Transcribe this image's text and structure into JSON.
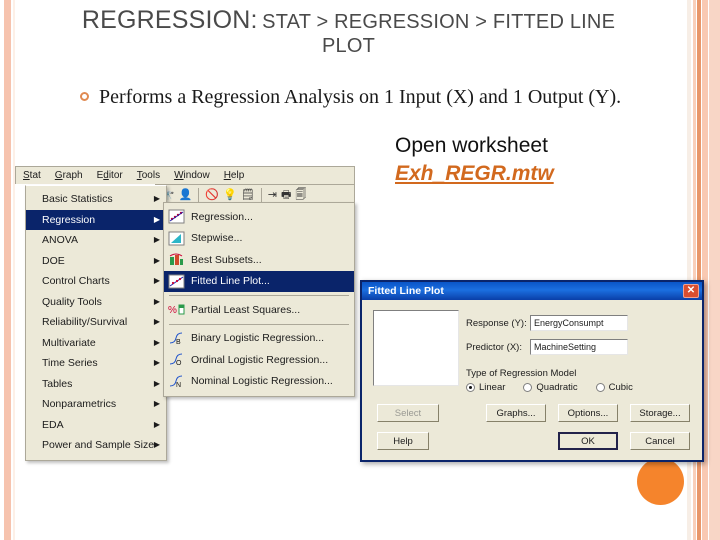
{
  "slide": {
    "title_main": "REGRESSION:",
    "title_path": "STAT > REGRESSION > FITTED LINE",
    "title_path_line2": "PLOT",
    "bullet_text": "Performs a Regression Analysis on 1 Input (X) and 1 Output (Y).",
    "worksheet_label": "Open worksheet",
    "worksheet_file": "Exh_REGR.mtw"
  },
  "colors": {
    "accent_orange": "#f5842c",
    "link_orange": "#d2691e",
    "stripe_peach": "#f6c3ae",
    "title_gray": "#4a4a4a",
    "menu_highlight": "#0a246a",
    "dialog_face": "#ece9d8"
  },
  "minitab": {
    "menubar": [
      {
        "label": "Stat",
        "accel": "S"
      },
      {
        "label": "Graph",
        "accel": "G"
      },
      {
        "label": "Editor",
        "accel": "d"
      },
      {
        "label": "Tools",
        "accel": "T"
      },
      {
        "label": "Window",
        "accel": "W"
      },
      {
        "label": "Help",
        "accel": "H"
      }
    ],
    "toolbar_icons": [
      "binoculars-icon",
      "person-find-icon",
      "no-entry-icon",
      "lightbulb-icon",
      "note-icon",
      "separator",
      "insert-cell-icon",
      "printer-icon",
      "print-preview-icon",
      "partial-icon"
    ],
    "stat_menu": [
      {
        "label": "Basic Statistics",
        "accel": "B",
        "selected": false,
        "submenu": true
      },
      {
        "label": "Regression",
        "accel": "R",
        "selected": true,
        "submenu": true
      },
      {
        "label": "ANOVA",
        "accel": "A",
        "selected": false,
        "submenu": true
      },
      {
        "label": "DOE",
        "accel": "D",
        "selected": false,
        "submenu": true
      },
      {
        "label": "Control Charts",
        "accel": "C",
        "selected": false,
        "submenu": true
      },
      {
        "label": "Quality Tools",
        "accel": "Q",
        "selected": false,
        "submenu": true
      },
      {
        "label": "Reliability/Survival",
        "accel": "l",
        "selected": false,
        "submenu": true
      },
      {
        "label": "Multivariate",
        "accel": "M",
        "selected": false,
        "submenu": true
      },
      {
        "label": "Time Series",
        "accel": "S",
        "selected": false,
        "submenu": true
      },
      {
        "label": "Tables",
        "accel": "T",
        "selected": false,
        "submenu": true
      },
      {
        "label": "Nonparametrics",
        "accel": "N",
        "selected": false,
        "submenu": true
      },
      {
        "label": "EDA",
        "accel": "E",
        "selected": false,
        "submenu": true
      },
      {
        "label": "Power and Sample Size",
        "accel": "P",
        "selected": false,
        "submenu": true
      }
    ],
    "regression_submenu": [
      {
        "label": "Regression...",
        "accel": "R",
        "selected": false,
        "icon": "scatter-plot-icon"
      },
      {
        "label": "Stepwise...",
        "accel": "S",
        "selected": false,
        "icon": "step-chart-icon"
      },
      {
        "label": "Best Subsets...",
        "accel": "B",
        "selected": false,
        "icon": "bar-chart-icon"
      },
      {
        "label": "Fitted Line Plot...",
        "accel": "F",
        "selected": true,
        "icon": "fitted-line-icon"
      },
      {
        "label": "Partial Least Squares...",
        "accel": "P",
        "selected": false,
        "icon": "pls-icon"
      },
      {
        "label": "Binary Logistic Regression...",
        "accel": "L",
        "selected": false,
        "icon": "logistic-b-icon"
      },
      {
        "label": "Ordinal Logistic Regression...",
        "accel": "O",
        "selected": false,
        "icon": "logistic-o-icon"
      },
      {
        "label": "Nominal Logistic Regression...",
        "accel": "N",
        "selected": false,
        "icon": "logistic-n-icon"
      }
    ]
  },
  "dialog": {
    "title": "Fitted Line Plot",
    "close_glyph": "✕",
    "response_label": "Response (Y):",
    "response_accel": "Y",
    "response_value": "EnergyConsumpt",
    "predictor_label": "Predictor (X):",
    "predictor_value": "MachineSetting",
    "model_group_label": "Type of Regression Model",
    "model_options": [
      {
        "label": "Linear",
        "accel": "L",
        "selected": true
      },
      {
        "label": "Quadratic",
        "accel": "Q",
        "selected": false
      },
      {
        "label": "Cubic",
        "accel": "C",
        "selected": false
      }
    ],
    "buttons": {
      "select": "Select",
      "graphs": "Graphs...",
      "options": "Options...",
      "storage": "Storage...",
      "help": "Help",
      "ok": "OK",
      "cancel": "Cancel"
    }
  }
}
